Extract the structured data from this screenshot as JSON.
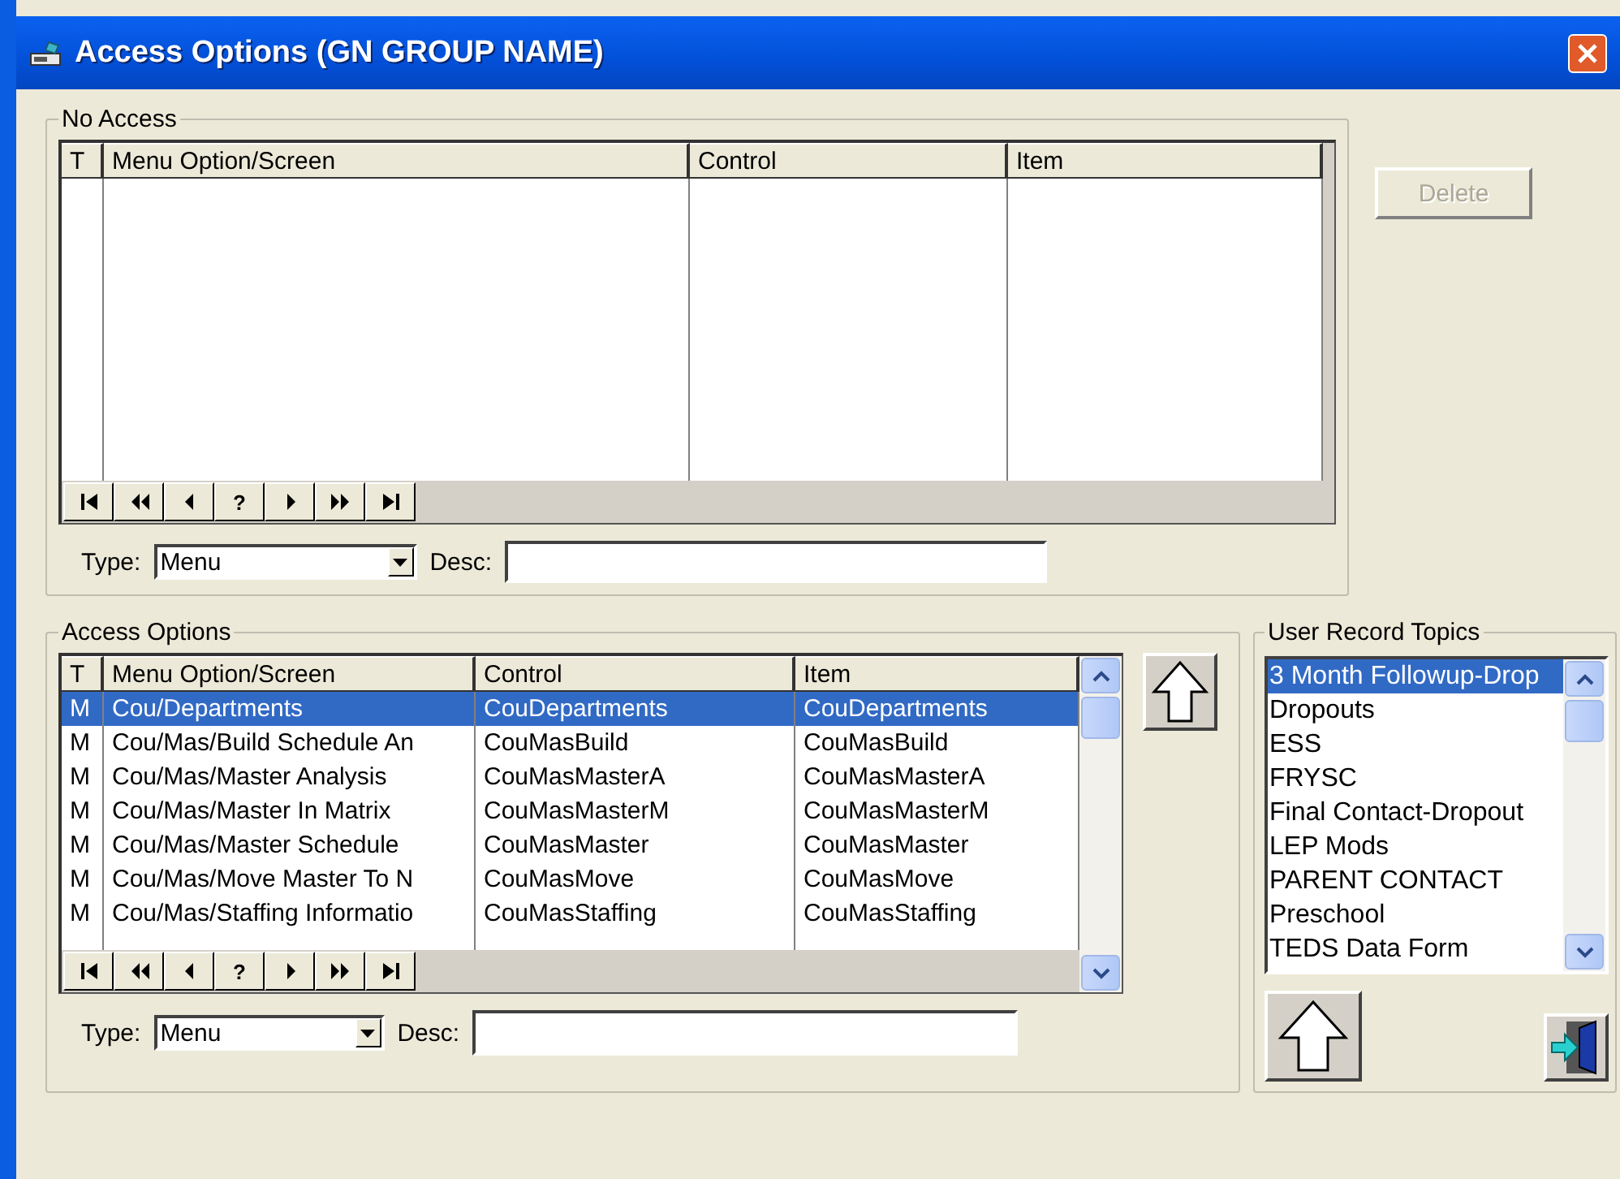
{
  "window": {
    "title": "Access Options (GN GROUP NAME)"
  },
  "no_access": {
    "label": "No Access",
    "columns": [
      "T",
      "Menu Option/Screen",
      "Control",
      "Item"
    ],
    "nav": [
      {
        "kind": "first"
      },
      {
        "kind": "prev_page"
      },
      {
        "kind": "prev"
      },
      {
        "kind": "text",
        "label": "?"
      },
      {
        "kind": "next"
      },
      {
        "kind": "next_page"
      },
      {
        "kind": "last"
      }
    ],
    "type": {
      "label": "Type:",
      "value": "Menu"
    },
    "desc": {
      "label": "Desc:"
    },
    "delete_button": {
      "label": "Delete",
      "disabled": true
    }
  },
  "access_options": {
    "label": "Access Options",
    "columns": [
      "T",
      "Menu Option/Screen",
      "Control",
      "Item"
    ],
    "rows": [
      {
        "cells": [
          "M",
          "Cou/Departments",
          "CouDepartments",
          "CouDepartments"
        ],
        "selected": true
      },
      {
        "cells": [
          "M",
          "Cou/Mas/Build Schedule An",
          "CouMasBuild",
          "CouMasBuild"
        ],
        "selected": false
      },
      {
        "cells": [
          "M",
          "Cou/Mas/Master Analysis",
          "CouMasMasterA",
          "CouMasMasterA"
        ],
        "selected": false
      },
      {
        "cells": [
          "M",
          "Cou/Mas/Master In Matrix",
          "CouMasMasterM",
          "CouMasMasterM"
        ],
        "selected": false
      },
      {
        "cells": [
          "M",
          "Cou/Mas/Master Schedule",
          "CouMasMaster",
          "CouMasMaster"
        ],
        "selected": false
      },
      {
        "cells": [
          "M",
          "Cou/Mas/Move Master To N",
          "CouMasMove",
          "CouMasMove"
        ],
        "selected": false
      },
      {
        "cells": [
          "M",
          "Cou/Mas/Staffing Informatio",
          "CouMasStaffing",
          "CouMasStaffing"
        ],
        "selected": false
      }
    ],
    "nav": [
      {
        "kind": "first"
      },
      {
        "kind": "prev_page"
      },
      {
        "kind": "prev"
      },
      {
        "kind": "text",
        "label": "?"
      },
      {
        "kind": "next"
      },
      {
        "kind": "next_page"
      },
      {
        "kind": "last"
      }
    ],
    "type": {
      "label": "Type:",
      "value": "Menu"
    },
    "desc": {
      "label": "Desc:"
    }
  },
  "user_record_topics": {
    "label": "User Record Topics",
    "items": [
      {
        "label": "3 Month Followup-Drop",
        "selected": true
      },
      {
        "label": "Dropouts",
        "selected": false
      },
      {
        "label": "ESS",
        "selected": false
      },
      {
        "label": "FRYSC",
        "selected": false
      },
      {
        "label": "Final Contact-Dropout",
        "selected": false
      },
      {
        "label": "LEP Mods",
        "selected": false
      },
      {
        "label": "PARENT CONTACT",
        "selected": false
      },
      {
        "label": "Preschool",
        "selected": false
      },
      {
        "label": "TEDS Data Form",
        "selected": false
      }
    ]
  }
}
